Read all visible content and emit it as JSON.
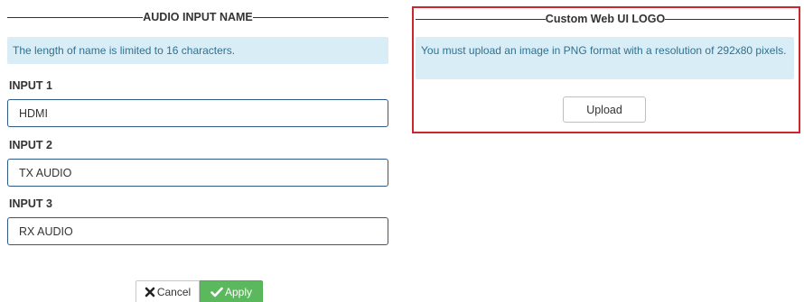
{
  "audio_section": {
    "title": "AUDIO INPUT NAME",
    "info": "The length of name is limited to 16 characters.",
    "inputs": [
      {
        "label": "INPUT 1",
        "value": "HDMI"
      },
      {
        "label": "INPUT 2",
        "value": "TX AUDIO"
      },
      {
        "label": "INPUT 3",
        "value": "RX AUDIO"
      }
    ]
  },
  "logo_section": {
    "title": "Custom Web UI LOGO",
    "info": "You must upload an image in PNG format with a resolution of 292x80 pixels.",
    "upload_label": "Upload",
    "highlight_color": "#d0232a"
  },
  "actions": {
    "cancel_label": "Cancel",
    "apply_label": "Apply",
    "apply_color": "#5cb85c"
  },
  "icons": {
    "cancel": "close-icon",
    "apply": "check-icon"
  }
}
